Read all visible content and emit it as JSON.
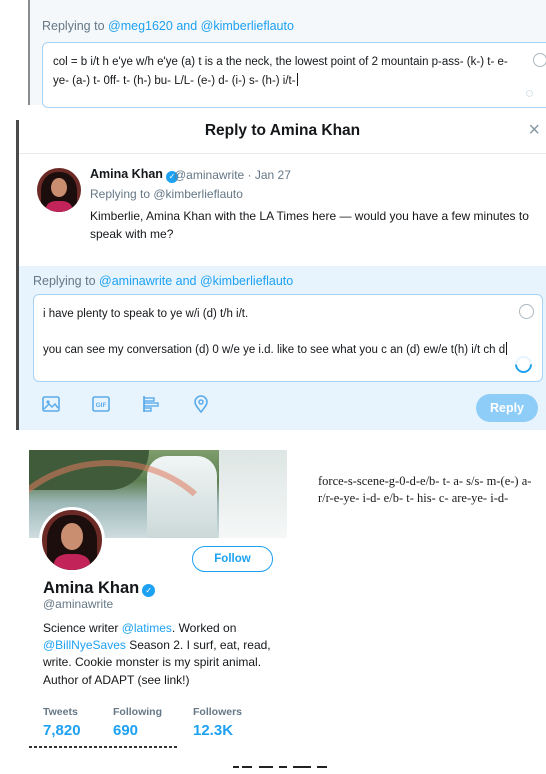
{
  "top_snippet": {
    "replying_prefix": "Replying to ",
    "mention1": "@meg1620",
    "and": " and ",
    "mention2": "@kimberlieflauto",
    "draft_text": "col = b i/t h e'ye w/h e'ye (a) t  is a the neck, the lowest point of 2 mountain p-ass- (k-) t- e- ye- (a-) t- 0ff- t- (h-) bu- L/L- (e-) d- (i-) s- (h-) i/t-"
  },
  "dialog": {
    "title": "Reply to Amina Khan",
    "close_glyph": "×",
    "tweet": {
      "author_name": "Amina Khan",
      "verified_glyph": "✓",
      "meta": "@aminawrite · Jan 27",
      "replying_line": "Replying to @kimberlieflauto",
      "text": "Kimberlie, Amina Khan with the LA Times here — would you have a few minutes to speak with me?"
    },
    "compose": {
      "replying_prefix": "Replying to ",
      "mentions": "@aminawrite and @kimberlieflauto",
      "draft_text": "i have plenty to speak to ye w/i (d) t/h i/t.\n\nyou can see my conversation (d) 0 w/e  ye i.d.  like to see what you c an (d) ew/e t(h) i/t ch d"
    },
    "toolbar": {
      "icons": [
        "image-icon",
        "gif-icon",
        "poll-icon",
        "location-icon"
      ],
      "gif_label": "GIF"
    },
    "reply_button": "Reply"
  },
  "profile": {
    "follow_button": "Follow",
    "name": "Amina Khan",
    "handle": "@aminawrite",
    "bio": {
      "part1": "Science writer ",
      "mention1": "@latimes",
      "part2": ". Worked on ",
      "mention2": "@BillNyeSaves",
      "part3": " Season 2. I surf, eat, read, write. Cookie monster is my spirit animal. Author of ADAPT (see link!)"
    },
    "stats": [
      {
        "label": "Tweets",
        "value": "7,820"
      },
      {
        "label": "Following",
        "value": "690"
      },
      {
        "label": "Followers",
        "value": "12.3K"
      }
    ]
  },
  "note": {
    "text": "force-s-scene-g-0-d-e/b- t- a- s/s- m-(e-) a- r/r-e-ye- i-d- e/b- t- his- c- are-ye- i-d-"
  },
  "colors": {
    "accent": "#1da1f2",
    "compose_bg": "#e8f4fd",
    "muted_text": "#657786",
    "reply_button_bg": "#8ecdf8"
  }
}
